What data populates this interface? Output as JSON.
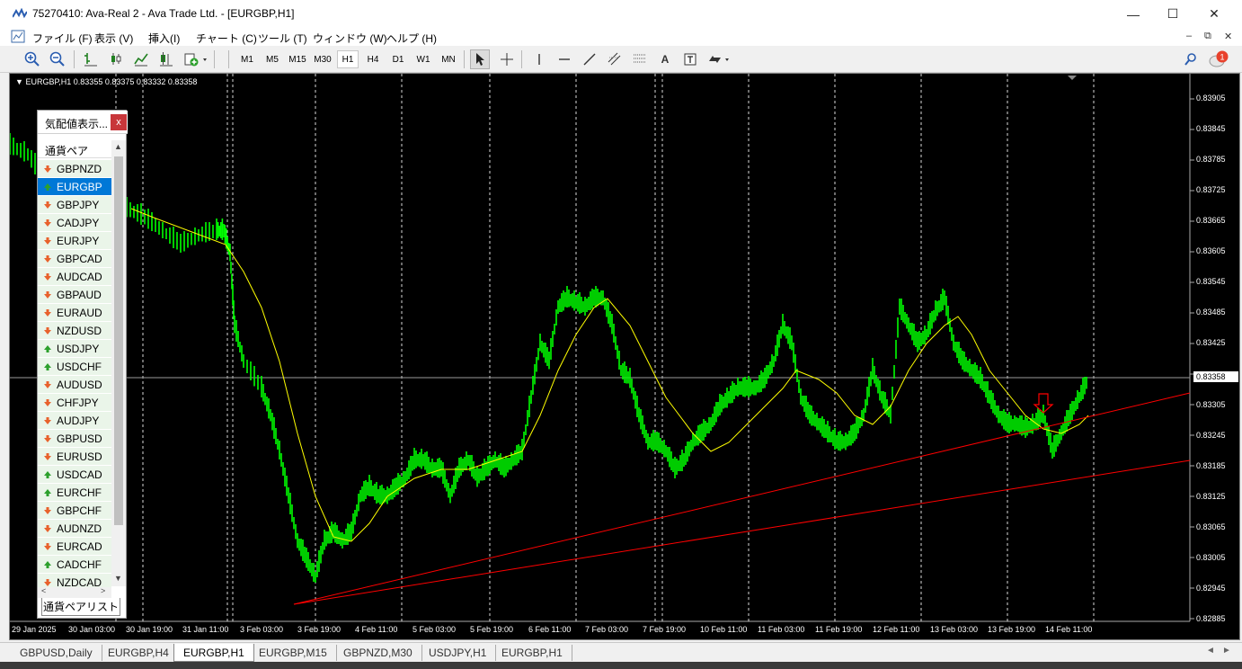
{
  "window": {
    "title": "75270410: Ava-Real 2 - Ava Trade Ltd. - [EURGBP,H1]",
    "minimize_icon": "minimize-icon",
    "maximize_icon": "maximize-icon",
    "close_icon": "close-icon"
  },
  "menu": {
    "items": [
      "ファイル (F)",
      "表示 (V)",
      "挿入(I)",
      "チャート (C)",
      "ツール (T)",
      "ウィンドウ (W)",
      "ヘルプ (H)"
    ]
  },
  "toolbar": {
    "timeframes": [
      "M1",
      "M5",
      "M15",
      "M30",
      "H1",
      "H4",
      "D1",
      "W1",
      "MN"
    ],
    "active_timeframe": "H1",
    "icons": [
      "zoom-in-icon",
      "zoom-out-icon",
      "bar-chart-icon",
      "candle-chart-icon",
      "line-chart-icon",
      "chart-shift-icon",
      "new-order-icon",
      "cursor-icon",
      "crosshair-icon",
      "vertical-line-icon",
      "horizontal-line-icon",
      "trendline-icon",
      "equidistant-channel-icon",
      "fibonacci-icon",
      "text-icon",
      "text-label-icon",
      "arrows-icon",
      "search-icon",
      "notification-icon"
    ],
    "notification_count": "1"
  },
  "chart": {
    "header": "EURGBP,H1  0.83355 0.83375 0.83332 0.83358",
    "price_labels": [
      "0.83905",
      "0.83845",
      "0.83785",
      "0.83725",
      "0.83665",
      "0.83605",
      "0.83545",
      "0.83485",
      "0.83425",
      "0.83305",
      "0.83245",
      "0.83185",
      "0.83125",
      "0.83065",
      "0.83005",
      "0.82945",
      "0.82885"
    ],
    "current_price": "0.83358",
    "time_labels": [
      "29 Jan 2025",
      "30 Jan 03:00",
      "30 Jan 19:00",
      "31 Jan 11:00",
      "3 Feb 03:00",
      "3 Feb 19:00",
      "4 Feb 11:00",
      "5 Feb 03:00",
      "5 Feb 19:00",
      "6 Feb 11:00",
      "7 Feb 03:00",
      "7 Feb 19:00",
      "10 Feb 11:00",
      "11 Feb 03:00",
      "11 Feb 19:00",
      "12 Feb 11:00",
      "13 Feb 03:00",
      "13 Feb 19:00",
      "14 Feb 11:00"
    ],
    "colors": {
      "bull": "#00ff00",
      "ma": "#ffff00",
      "trendline": "#ff0000",
      "grid": "#ffffff",
      "background": "#000000"
    }
  },
  "market_watch": {
    "title": "気配値表示...",
    "column_header": "通貨ペア",
    "tab_label": "通貨ペアリスト",
    "symbols": [
      {
        "name": "GBPNZD",
        "dir": "down"
      },
      {
        "name": "EURGBP",
        "dir": "up",
        "selected": true
      },
      {
        "name": "GBPJPY",
        "dir": "down"
      },
      {
        "name": "CADJPY",
        "dir": "down"
      },
      {
        "name": "EURJPY",
        "dir": "down"
      },
      {
        "name": "GBPCAD",
        "dir": "down"
      },
      {
        "name": "AUDCAD",
        "dir": "down"
      },
      {
        "name": "GBPAUD",
        "dir": "down"
      },
      {
        "name": "EURAUD",
        "dir": "down"
      },
      {
        "name": "NZDUSD",
        "dir": "down"
      },
      {
        "name": "USDJPY",
        "dir": "up"
      },
      {
        "name": "USDCHF",
        "dir": "up"
      },
      {
        "name": "AUDUSD",
        "dir": "down"
      },
      {
        "name": "CHFJPY",
        "dir": "down"
      },
      {
        "name": "AUDJPY",
        "dir": "down"
      },
      {
        "name": "GBPUSD",
        "dir": "down"
      },
      {
        "name": "EURUSD",
        "dir": "down"
      },
      {
        "name": "USDCAD",
        "dir": "up"
      },
      {
        "name": "EURCHF",
        "dir": "up"
      },
      {
        "name": "GBPCHF",
        "dir": "down"
      },
      {
        "name": "AUDNZD",
        "dir": "down"
      },
      {
        "name": "EURCAD",
        "dir": "down"
      },
      {
        "name": "CADCHF",
        "dir": "up"
      },
      {
        "name": "NZDCAD",
        "dir": "down"
      }
    ]
  },
  "bottom_tabs": [
    "GBPUSD,Daily",
    "EURGBP,H4",
    "EURGBP,H1",
    "EURGBP,M15",
    "GBPNZD,M30",
    "USDJPY,H1",
    "EURGBP,H1"
  ],
  "active_bottom_tab": "EURGBP,H1"
}
